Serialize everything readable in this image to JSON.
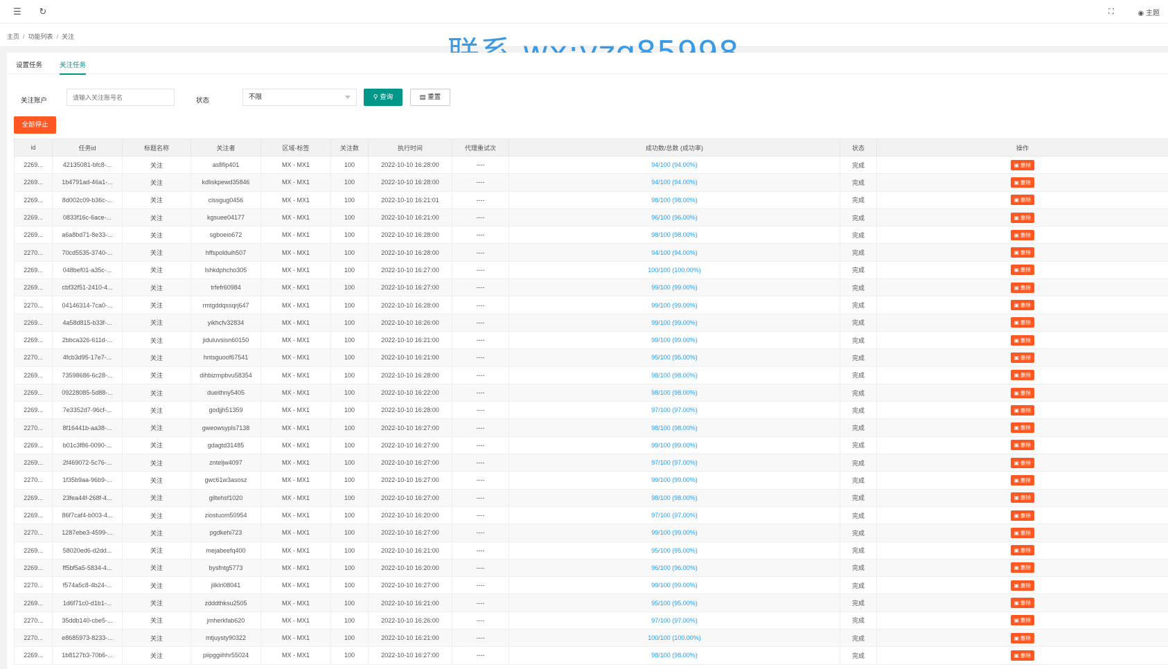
{
  "topbar": {
    "menu_icon": "menu-icon",
    "refresh_icon": "refresh-icon",
    "fullscreen_icon": "fullscreen-icon",
    "theme_label": "主题"
  },
  "breadcrumb": [
    "主页",
    "功能列表",
    "关注"
  ],
  "watermark": "联系 wx:yzq85998",
  "tabs": [
    {
      "label": "设置任务"
    },
    {
      "label": "关注任务"
    }
  ],
  "search": {
    "account_label": "关注账户",
    "account_placeholder": "请输入关注账号名",
    "status_label": "状态",
    "status_value": "不限",
    "query_label": "查询",
    "reset_label": "重置"
  },
  "stop_all_label": "全部停止",
  "table": {
    "columns": [
      "id",
      "任务id",
      "标题名称",
      "关注者",
      "区域-标签",
      "关注数",
      "执行时间",
      "代理重试次",
      "成功数/总数 (成功率)",
      "状态",
      "操作"
    ],
    "delete_label": "删除",
    "rows": [
      [
        "2269...",
        "42135081-bfc8-...",
        "关注",
        "asfifip401",
        "MX - MX1",
        "100",
        "2022-10-10 16:28:00",
        "----",
        "94/100 (94.00%)",
        "完成"
      ],
      [
        "2269...",
        "1b4791ad-46a1-...",
        "关注",
        "kdliskpewd35846",
        "MX - MX1",
        "100",
        "2022-10-10 16:28:00",
        "----",
        "94/100 (94.00%)",
        "完成"
      ],
      [
        "2269...",
        "8d002c09-b36c-...",
        "关注",
        "cissgug0456",
        "MX - MX1",
        "100",
        "2022-10-10 16:21:01",
        "----",
        "98/100 (98.00%)",
        "完成"
      ],
      [
        "2269...",
        "0833f16c-6ace-...",
        "关注",
        "kgsuee04177",
        "MX - MX1",
        "100",
        "2022-10-10 16:21:00",
        "----",
        "96/100 (96.00%)",
        "完成"
      ],
      [
        "2269...",
        "a6a8bd71-8e33-...",
        "关注",
        "sgboeio672",
        "MX - MX1",
        "100",
        "2022-10-10 16:28:00",
        "----",
        "98/100 (98.00%)",
        "完成"
      ],
      [
        "2270...",
        "70cd5535-3740-...",
        "关注",
        "hffspolduih507",
        "MX - MX1",
        "100",
        "2022-10-10 16:28:00",
        "----",
        "94/100 (94.00%)",
        "完成"
      ],
      [
        "2269...",
        "048bef01-a35c-...",
        "关注",
        "lshkdphcho305",
        "MX - MX1",
        "100",
        "2022-10-10 16:27:00",
        "----",
        "100/100 (100.00%)",
        "完成"
      ],
      [
        "2269...",
        "cbf32f51-2410-4...",
        "关注",
        "trfefr60984",
        "MX - MX1",
        "100",
        "2022-10-10 16:27:00",
        "----",
        "99/100 (99.00%)",
        "完成"
      ],
      [
        "2270...",
        "04146314-7ca0-...",
        "关注",
        "rmtgddqssqrj647",
        "MX - MX1",
        "100",
        "2022-10-10 16:28:00",
        "----",
        "99/100 (99.00%)",
        "完成"
      ],
      [
        "2269...",
        "4a58d815-b33f-...",
        "关注",
        "yikhcfv32834",
        "MX - MX1",
        "100",
        "2022-10-10 16:26:00",
        "----",
        "99/100 (99.00%)",
        "完成"
      ],
      [
        "2269...",
        "2bbca326-611d-...",
        "关注",
        "jiduluvsisn60150",
        "MX - MX1",
        "100",
        "2022-10-10 16:21:00",
        "----",
        "99/100 (99.00%)",
        "完成"
      ],
      [
        "2270...",
        "4fcb3d95-17e7-...",
        "关注",
        "hntsguoof67541",
        "MX - MX1",
        "100",
        "2022-10-10 16:21:00",
        "----",
        "95/100 (95.00%)",
        "完成"
      ],
      [
        "2269...",
        "73598686-6c28-...",
        "关注",
        "dihbizmpbvu58354",
        "MX - MX1",
        "100",
        "2022-10-10 16:28:00",
        "----",
        "98/100 (98.00%)",
        "完成"
      ],
      [
        "2269...",
        "09228085-5d88-...",
        "关注",
        "dueithny5405",
        "MX - MX1",
        "100",
        "2022-10-10 16:22:00",
        "----",
        "98/100 (98.00%)",
        "完成"
      ],
      [
        "2269...",
        "7e3352d7-96cf-...",
        "关注",
        "godjjh51359",
        "MX - MX1",
        "100",
        "2022-10-10 16:28:00",
        "----",
        "97/100 (97.00%)",
        "完成"
      ],
      [
        "2270...",
        "8f16441b-aa38-...",
        "关注",
        "gweowsypls7138",
        "MX - MX1",
        "100",
        "2022-10-10 16:27:00",
        "----",
        "98/100 (98.00%)",
        "完成"
      ],
      [
        "2269...",
        "b01c3f86-0090-...",
        "关注",
        "gdagtd31485",
        "MX - MX1",
        "100",
        "2022-10-10 16:27:00",
        "----",
        "99/100 (99.00%)",
        "完成"
      ],
      [
        "2269...",
        "2f469072-5c76-...",
        "关注",
        "znteljw4097",
        "MX - MX1",
        "100",
        "2022-10-10 16:27:00",
        "----",
        "97/100 (97.00%)",
        "完成"
      ],
      [
        "2270...",
        "1f35b9aa-96b9-...",
        "关注",
        "gwc61w3asosz",
        "MX - MX1",
        "100",
        "2022-10-10 16:27:00",
        "----",
        "99/100 (99.00%)",
        "完成"
      ],
      [
        "2269...",
        "23fea44f-268f-4...",
        "关注",
        "giltehsf1020",
        "MX - MX1",
        "100",
        "2022-10-10 16:27:00",
        "----",
        "98/100 (98.00%)",
        "完成"
      ],
      [
        "2269...",
        "86f7caf4-b003-4...",
        "关注",
        "ziostuom50954",
        "MX - MX1",
        "100",
        "2022-10-10 16:20:00",
        "----",
        "97/100 (97.00%)",
        "完成"
      ],
      [
        "2270...",
        "1287ebe3-4599-...",
        "关注",
        "pgdkehi723",
        "MX - MX1",
        "100",
        "2022-10-10 16:27:00",
        "----",
        "99/100 (99.00%)",
        "完成"
      ],
      [
        "2269...",
        "58020ed6-d2dd...",
        "关注",
        "mejabeefq400",
        "MX - MX1",
        "100",
        "2022-10-10 16:21:00",
        "----",
        "95/100 (95.00%)",
        "完成"
      ],
      [
        "2269...",
        "ff5bf5a5-5834-4...",
        "关注",
        "bysfntg5773",
        "MX - MX1",
        "100",
        "2022-10-10 16:20:00",
        "----",
        "96/100 (96.00%)",
        "完成"
      ],
      [
        "2270...",
        "f574a5c8-4b24-...",
        "关注",
        "jilklri08041",
        "MX - MX1",
        "100",
        "2022-10-10 16:27:00",
        "----",
        "99/100 (99.00%)",
        "完成"
      ],
      [
        "2269...",
        "1d6f71c0-d1b1-...",
        "关注",
        "zdddthksu2505",
        "MX - MX1",
        "100",
        "2022-10-10 16:21:00",
        "----",
        "95/100 (95.00%)",
        "完成"
      ],
      [
        "2270...",
        "35ddb140-cbe5-...",
        "关注",
        "jmherkfab620",
        "MX - MX1",
        "100",
        "2022-10-10 16:26:00",
        "----",
        "97/100 (97.00%)",
        "完成"
      ],
      [
        "2270...",
        "e8685973-8233-...",
        "关注",
        "mtjuysty90322",
        "MX - MX1",
        "100",
        "2022-10-10 16:21:00",
        "----",
        "100/100 (100.00%)",
        "完成"
      ],
      [
        "2269...",
        "1b8127b3-70b6-...",
        "关注",
        "piipggiihhr55024",
        "MX - MX1",
        "100",
        "2022-10-10 16:27:00",
        "----",
        "98/100 (98.00%)",
        "完成"
      ]
    ]
  }
}
